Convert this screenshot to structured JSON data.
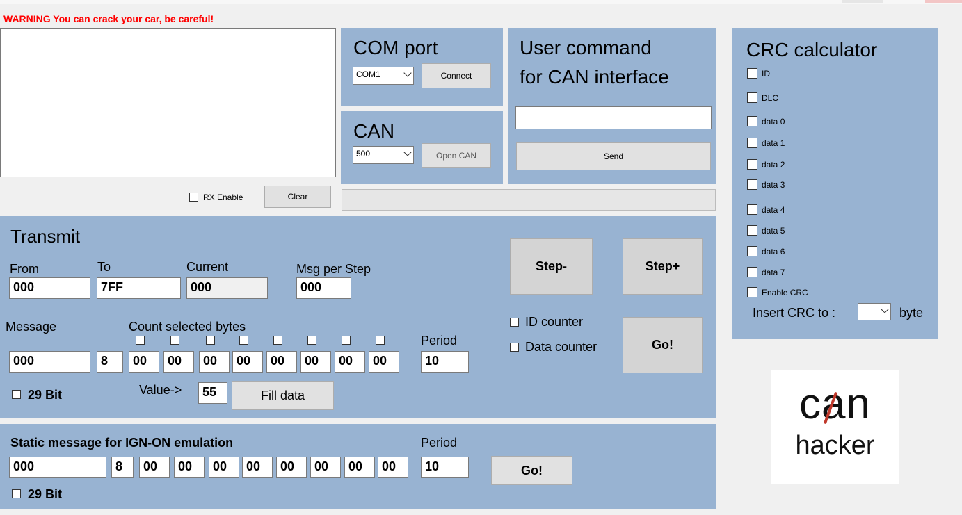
{
  "warning": "WARNING You can crack your car, be careful!",
  "rx": {
    "enable_label": "RX Enable",
    "clear_label": "Clear"
  },
  "com": {
    "title": "COM port",
    "port_value": "COM1",
    "connect_label": "Connect"
  },
  "can": {
    "title": "CAN",
    "speed_value": "500",
    "open_label": "Open CAN"
  },
  "user_cmd": {
    "title_line1": "User command",
    "title_line2": "for CAN interface",
    "input_value": "",
    "send_label": "Send"
  },
  "crc": {
    "title": "CRC calculator",
    "items": [
      "ID",
      "DLC",
      "data 0",
      "data 1",
      "data 2",
      "data 3",
      "data 4",
      "data 5",
      "data 6",
      "data 7",
      "Enable CRC"
    ],
    "insert_label": "Insert CRC to :",
    "byte_value": "",
    "byte_label": "byte"
  },
  "transmit": {
    "title": "Transmit",
    "from_label": "From",
    "to_label": "To",
    "current_label": "Current",
    "msg_per_step_label": "Msg per Step",
    "from_value": "000",
    "to_value": "7FF",
    "current_value": "000",
    "msg_per_step_value": "000",
    "step_minus_label": "Step-",
    "step_plus_label": "Step+",
    "message_label": "Message",
    "count_label": "Count selected bytes",
    "period_label": "Period",
    "id_counter_label": "ID counter",
    "data_counter_label": "Data counter",
    "go_label": "Go!",
    "message_id": "000",
    "dlc": "8",
    "bytes": [
      "00",
      "00",
      "00",
      "00",
      "00",
      "00",
      "00",
      "00"
    ],
    "period_value": "10",
    "bit29_label": "29 Bit",
    "value_label": "Value->",
    "value_value": "55",
    "fill_label": "Fill data"
  },
  "static_msg": {
    "title": "Static message for IGN-ON emulation",
    "period_label": "Period",
    "message_id": "000",
    "dlc": "8",
    "bytes": [
      "00",
      "00",
      "00",
      "00",
      "00",
      "00",
      "00",
      "00"
    ],
    "period_value": "10",
    "go_label": "Go!",
    "bit29_label": "29 Bit"
  },
  "logo": {
    "text_top": "can",
    "text_bottom": "hacker",
    "accent": "#c0392b"
  },
  "colors": {
    "panel": "#98b3d2",
    "warning": "#ff0000"
  }
}
